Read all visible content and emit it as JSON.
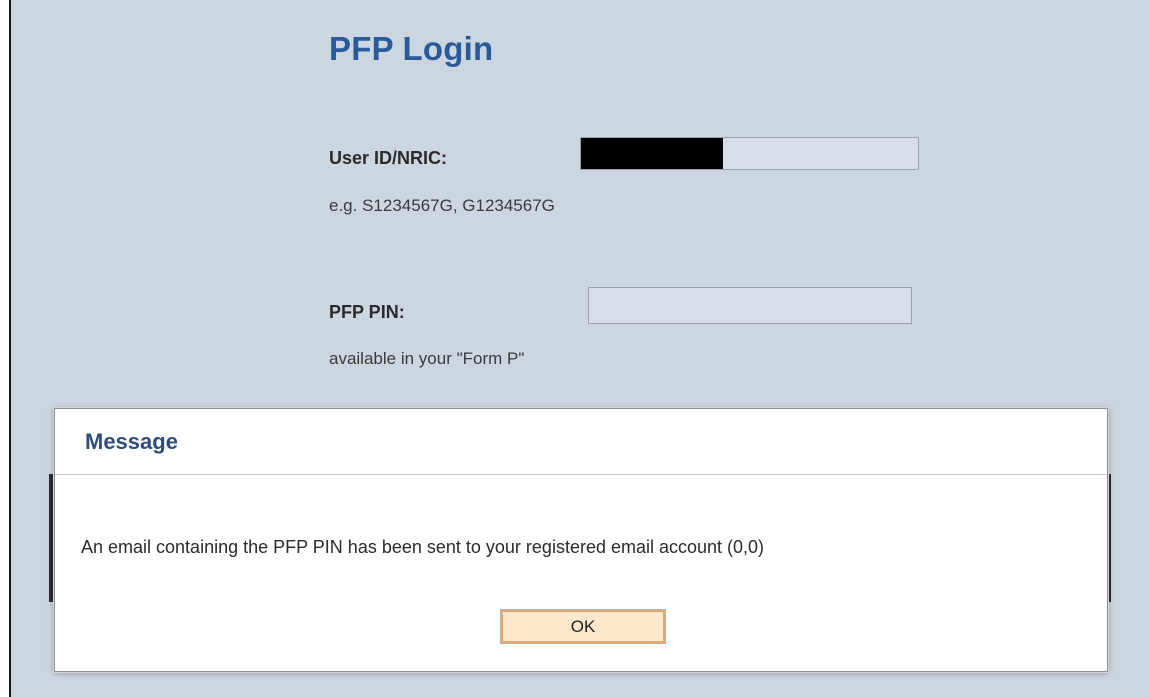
{
  "login": {
    "title": "PFP Login",
    "user_id_label": "User ID/NRIC:",
    "user_id_hint": "e.g. S1234567G, G1234567G",
    "pin_label": "PFP PIN:",
    "pin_hint": "available in your \"Form P\"",
    "user_id_value": "",
    "pin_value": ""
  },
  "modal": {
    "title": "Message",
    "message": "An email containing the PFP PIN has been sent to your registered email account (0,0)",
    "ok_label": "OK"
  },
  "colors": {
    "background": "#ccd6e1",
    "title": "#2a5a9a",
    "modal_title": "#2e4d7c",
    "button_fill": "#fde8ce",
    "button_border": "#e4a86a"
  }
}
